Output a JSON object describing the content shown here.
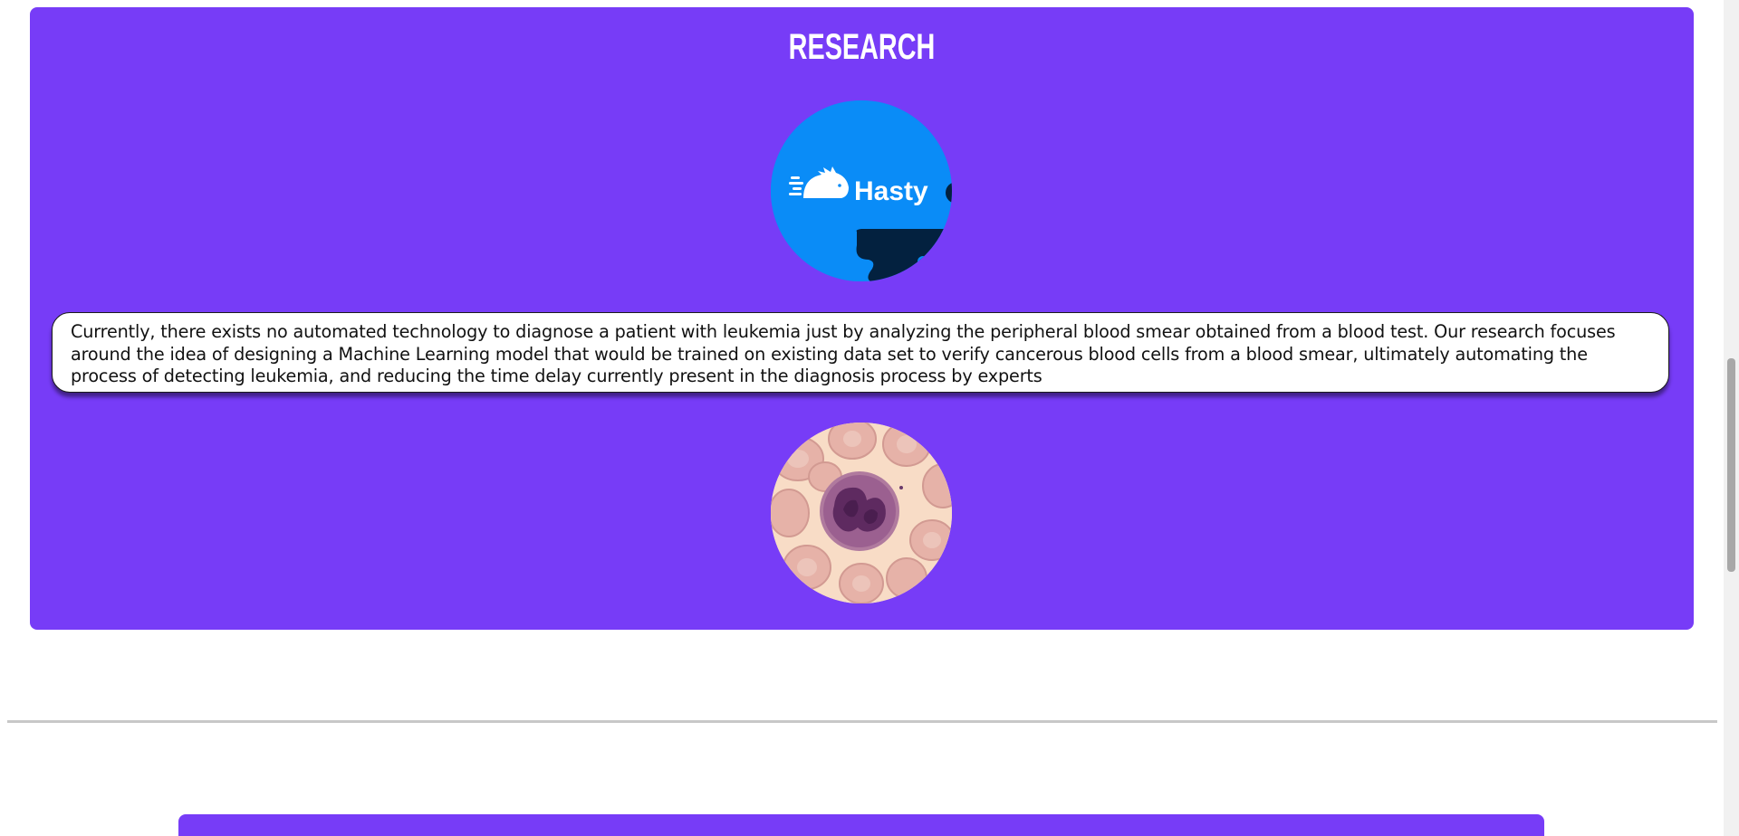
{
  "research": {
    "title": "RESEARCH",
    "logo": {
      "name": "hasty-logo",
      "text": "Hasty",
      "colors": {
        "background": "#0a8cf7",
        "text": "#ffffff",
        "accent": "#03213f"
      }
    },
    "description": "Currently, there exists no automated technology to diagnose a patient with leukemia just by analyzing the peripheral blood smear obtained from a blood test. Our research focuses around the idea of designing a Machine Learning model that would be trained on existing data set to verify cancerous blood cells from a blood smear, ultimately automating the process of detecting leukemia, and reducing the time delay currently present in the diagnosis process by experts",
    "image": {
      "name": "blood-smear-image"
    }
  },
  "colors": {
    "section_background": "#773cf7",
    "card_background": "#ffffff",
    "page_background": "#ffffff"
  }
}
